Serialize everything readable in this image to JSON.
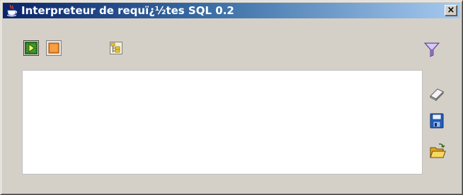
{
  "window": {
    "title": "Interpreteur de requï¿½tes SQL 0.2",
    "title_icon": "java-cup-icon",
    "close_label": "×"
  },
  "toolbar": {
    "buttons": [
      {
        "name": "run-query-button",
        "icon": "execute-icon"
      },
      {
        "name": "stop-query-button",
        "icon": "stop-icon"
      },
      {
        "name": "schema-tree-button",
        "icon": "tree-view-icon"
      },
      {
        "name": "filter-button",
        "icon": "funnel-filter-icon"
      }
    ]
  },
  "side_buttons": [
    {
      "name": "clear-button",
      "icon": "eraser-icon"
    },
    {
      "name": "save-button",
      "icon": "floppy-disk-icon"
    },
    {
      "name": "open-button",
      "icon": "open-folder-icon"
    }
  ],
  "editor": {
    "value": ""
  },
  "colors": {
    "titlebar_start": "#0a246a",
    "titlebar_end": "#a6caf0",
    "window_bg": "#d4d0c8",
    "run_green": "#3c9a28",
    "stop_orange": "#f08020",
    "filter_purple": "#8a6ab8",
    "save_blue": "#2060c0",
    "folder_yellow": "#f0c830"
  }
}
